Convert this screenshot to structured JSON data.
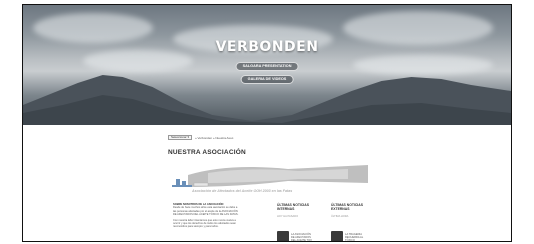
{
  "hero": {
    "title": "VERBONDEN",
    "button_1": "SALGARA PRESENTATION",
    "button_2": "GALERIA DE VIDEOS"
  },
  "breadcrumb": {
    "select_label": "Seleccionar",
    "trail": "» Verbonden  »  Nuestra Asoc."
  },
  "page": {
    "title": "NUESTRA ASOCIACIÓN",
    "banner_caption": "Asociación de Afectados del Aceite OOH 2003 en las Fatas"
  },
  "intro": {
    "heading": "SOBRE NOSOTROS DE LA ASOCIACIÓN",
    "paragraph_1": "Desde de hace muchos años esta asociación se debe a las personas afectadas por el aceite de la ASOCIACIÓN DE AFECTADOS DEL ACEITE TÓXICO DE LAS FATAS.",
    "paragraph_2": "Con nuestra labor intentamos que esto nunca vuelva a ocurrir y que los derechos de todos los afectados sean reconocidos para siempre y para todos."
  },
  "columns": {
    "col1_title": "ÚLTIMAS NOTICIAS INTERNAS",
    "col1_sub": "HOY HA PASADO",
    "col1_news": "LA ASOCIACIÓN DE AFECTADOS DEL ACEITE TOX",
    "col2_title": "ÚLTIMAS NOTICIAS EXTERNAS",
    "col2_sub": "ÚLTIMA HORA",
    "col2_news": "LA TRAGEDIA RECUERDA AL TÓXICO"
  },
  "colors": {
    "frame": "#111111",
    "hero_button_bg": "#32373c",
    "text": "#333333"
  }
}
